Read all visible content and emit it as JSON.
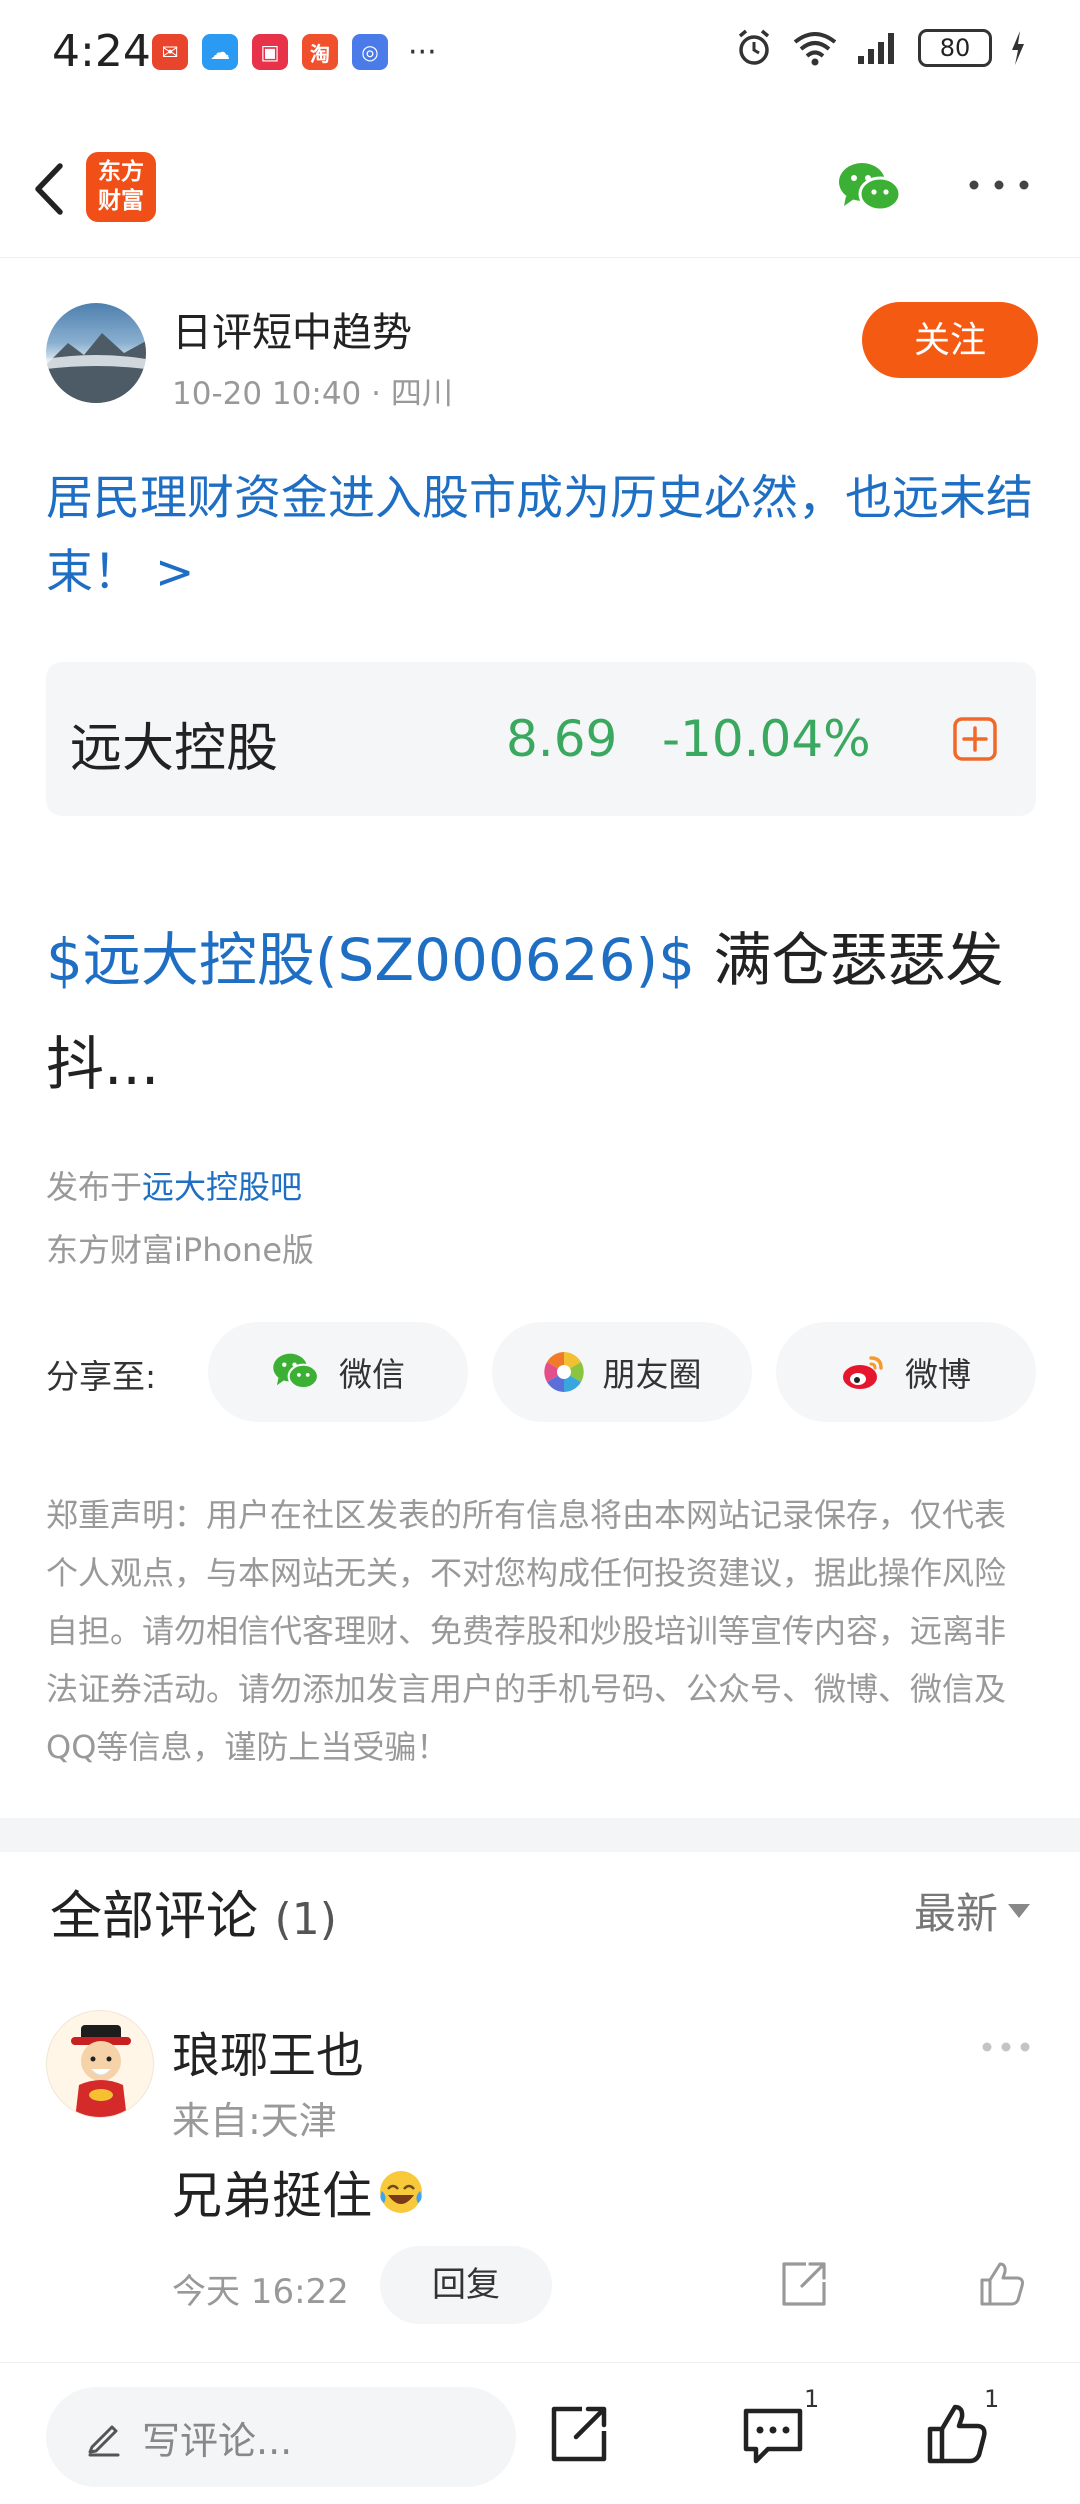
{
  "status_bar": {
    "time": "4:24",
    "battery": "80"
  },
  "nav": {
    "logo_line1": "东方",
    "logo_line2": "财富"
  },
  "author": {
    "name": "日评短中趋势",
    "datetime": "10-20 10:40",
    "location": "四川",
    "follow_label": "关注"
  },
  "post": {
    "title": "居民理财资金进入股市成为历史必然，也远未结束！ >",
    "stock_tag": "$远大控股(SZ000626)$",
    "body_text": " 满仓瑟瑟发抖...",
    "published_prefix": "发布于",
    "published_bar": "远大控股吧",
    "device": "东方财富iPhone版"
  },
  "stock": {
    "name": "远大控股",
    "price": "8.69",
    "change": "-10.04%"
  },
  "share": {
    "label": "分享至:",
    "wechat": "微信",
    "moments": "朋友圈",
    "weibo": "微博"
  },
  "disclaimer": "郑重声明：用户在社区发表的所有信息将由本网站记录保存，仅代表个人观点，与本网站无关，不对您构成任何投资建议，据此操作风险自担。请勿相信代客理财、免费荐股和炒股培训等宣传内容，远离非法证券活动。请勿添加发言用户的手机号码、公众号、微博、微信及QQ等信息，谨防上当受骗！",
  "comments": {
    "title": "全部评论",
    "count": "(1)",
    "sort_label": "最新",
    "items": [
      {
        "user": "琅琊王也",
        "from": "来自:天津",
        "text": "兄弟挺住",
        "time": "今天 16:22",
        "reply_label": "回复"
      }
    ]
  },
  "bottom_bar": {
    "placeholder": "写评论...",
    "comment_count": "1",
    "like_count": "1"
  },
  "colors": {
    "brand_orange": "#f55a13",
    "link_blue": "#1e6fc4",
    "stock_down_green": "#3aa85f"
  }
}
